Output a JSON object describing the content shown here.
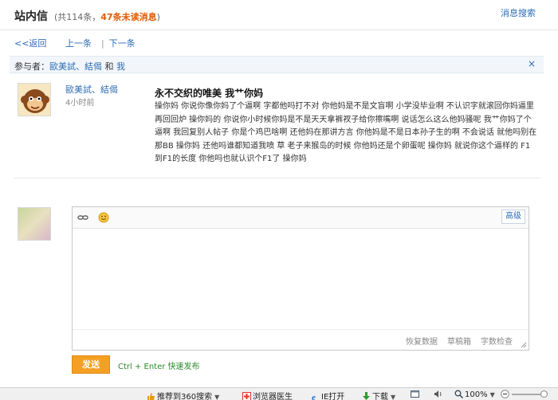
{
  "header": {
    "title": "站内信",
    "count_prefix": "(共114条，",
    "unread": "47条未读消息",
    "count_suffix": ")",
    "search_link": "消息搜索"
  },
  "nav": {
    "back": "<<返回",
    "prev": "上一条",
    "sep": "|",
    "next": "下一条"
  },
  "participants": {
    "label": "参与者：",
    "names": "歐美試、結偈",
    "and": "和",
    "me": "我",
    "close": "×"
  },
  "message": {
    "sender": "歐美試、結偈",
    "time": "4小时前",
    "subject": "永不交织的唯美 我艹你妈",
    "body": "操你妈 你说你像你妈了个逼啊 字都他吗打不对 你他妈是不是文盲啊 小学没毕业啊 不认识字就滚回你妈逼里再回回炉 操你妈的 你说你小时候你妈是不是天天拿裤衩子给你擦嘴啊 说话怎么这么他妈骚呢 我艹你妈了个逼啊 我回复别人帖子 你是个鸡巴啥啊 还他妈在那讲方言 你他妈是不是日本孙子生的啊 不会说话 就他吗别在那BB 操你妈 还他吗谁都知道我喷 草 老子来猴岛的时候 你他妈还是个卵蛋呢 操你妈 就说你这个逼样的 F1到F1的长度 你他吗也就认识个F1了 操你妈"
  },
  "editor": {
    "advanced": "高级",
    "footer": {
      "restore": "恢复数据",
      "draft": "草稿箱",
      "wordcount": "字数检查"
    }
  },
  "send": {
    "label": "发送",
    "shortcut": "Ctrl + Enter 快速发布"
  },
  "statusbar": {
    "recommend": "推荐到360搜索",
    "doctor": "浏览器医生",
    "ie_open": "IE打开",
    "download": "下载",
    "zoom": "100%"
  },
  "colors": {
    "link": "#2b6cb4",
    "unread": "#e05a00",
    "send_button": "#f3a024",
    "shortcut": "#2a8a2a"
  }
}
